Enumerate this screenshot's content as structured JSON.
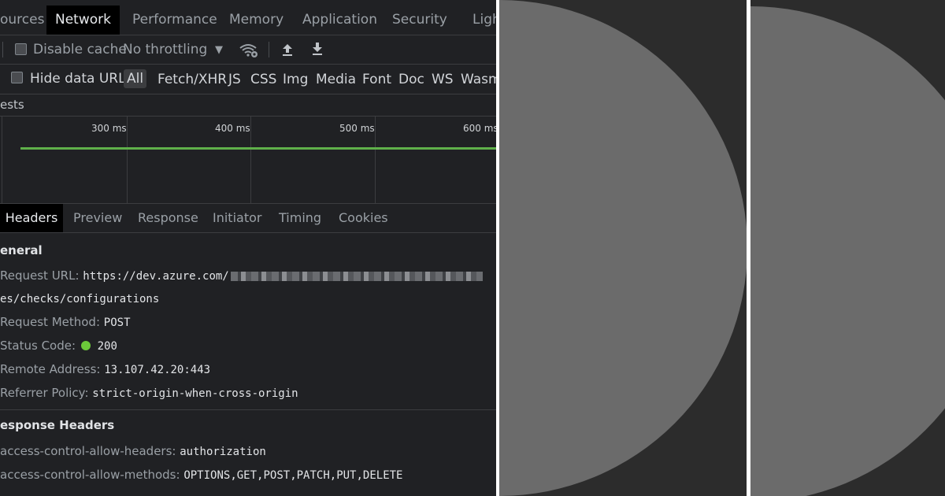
{
  "main_tabs": [
    {
      "label": "ources",
      "active": false
    },
    {
      "label": "Network",
      "active": true
    },
    {
      "label": "Performance",
      "active": false
    },
    {
      "label": "Memory",
      "active": false
    },
    {
      "label": "Application",
      "active": false
    },
    {
      "label": "Security",
      "active": false
    },
    {
      "label": "Ligh",
      "active": false
    }
  ],
  "toolbar": {
    "disable_cache": "Disable cache",
    "throttling": "No throttling",
    "wifi_icon": "wifi-icon",
    "upload_icon": "upload-icon",
    "download_icon": "download-icon"
  },
  "filter_bar": {
    "hide_data_urls": "Hide data URLs",
    "types": [
      "All",
      "Fetch/XHR",
      "JS",
      "CSS",
      "Img",
      "Media",
      "Font",
      "Doc",
      "WS",
      "Wasm"
    ],
    "active_type": "All"
  },
  "requests_label": "ests",
  "timeline": {
    "ticks": [
      "300 ms",
      "400 ms",
      "500 ms",
      "600 ms"
    ],
    "bar_color": "#5fb04a"
  },
  "detail_tabs": [
    {
      "label": "Headers",
      "active": true
    },
    {
      "label": "Preview",
      "active": false
    },
    {
      "label": "Response",
      "active": false
    },
    {
      "label": "Initiator",
      "active": false
    },
    {
      "label": "Timing",
      "active": false
    },
    {
      "label": "Cookies",
      "active": false
    }
  ],
  "general": {
    "title": "eneral",
    "request_url_key": "Request URL:",
    "request_url_value": "https://dev.azure.com/",
    "request_url_cont": "es/checks/configurations",
    "method_key": "Request Method:",
    "method_value": "POST",
    "status_key": "Status Code:",
    "status_value": "200",
    "remote_key": "Remote Address:",
    "remote_value": "13.107.42.20:443",
    "referrer_key": "Referrer Policy:",
    "referrer_value": "strict-origin-when-cross-origin"
  },
  "response_headers": {
    "title": "esponse Headers",
    "h1_key": "access-control-allow-headers:",
    "h1_value": "authorization",
    "h2_key": "access-control-allow-methods:",
    "h2_value": "OPTIONS,GET,POST,PATCH,PUT,DELETE"
  },
  "colors": {
    "panel_bg": "#2c2c2c",
    "half_circle": "#6b6b6b",
    "status_ok": "#6cc83a"
  }
}
